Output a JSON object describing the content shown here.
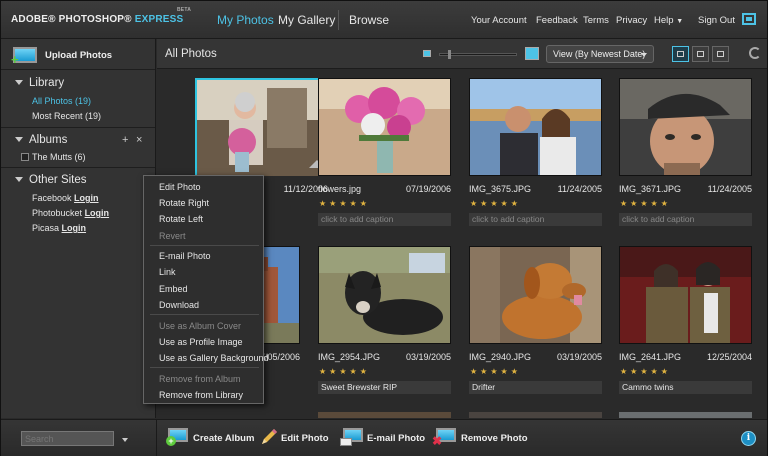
{
  "app": {
    "logo_prefix": "ADOBE® PHOTOSHOP®",
    "logo_express": "EXPRESS",
    "logo_beta": "BETA"
  },
  "topnav": {
    "my_photos": "My Photos",
    "my_gallery": "My Gallery",
    "browse": "Browse",
    "your_account": "Your Account",
    "feedback": "Feedback",
    "terms": "Terms",
    "privacy": "Privacy",
    "help": "Help",
    "sign_out": "Sign Out"
  },
  "sidebar": {
    "upload": "Upload Photos",
    "library": {
      "title": "Library",
      "items": [
        "All Photos (19)",
        "Most Recent (19)"
      ]
    },
    "albums": {
      "title": "Albums",
      "add": "+",
      "remove": "×",
      "items": [
        "The Mutts (6)"
      ]
    },
    "other_sites": {
      "title": "Other Sites",
      "sites": [
        {
          "name": "Facebook",
          "action": "Login"
        },
        {
          "name": "Photobucket",
          "action": "Login"
        },
        {
          "name": "Picasa",
          "action": "Login"
        }
      ]
    }
  },
  "main": {
    "title": "All Photos",
    "view_select": "View (By Newest Date)",
    "photos": [
      {
        "name": "",
        "date": "11/12/2006",
        "caption": "",
        "stars": "★★★★★"
      },
      {
        "name": "flowers.jpg",
        "date": "07/19/2006",
        "caption": "click to add caption",
        "stars": "★★★★★"
      },
      {
        "name": "IMG_3675.JPG",
        "date": "11/24/2005",
        "caption": "click to add caption",
        "stars": "★★★★★"
      },
      {
        "name": "IMG_3671.JPG",
        "date": "11/24/2005",
        "caption": "click to add caption",
        "stars": "★★★★★"
      },
      {
        "name": "",
        "date": "07/05/2006",
        "caption": "",
        "stars": ""
      },
      {
        "name": "IMG_2954.JPG",
        "date": "03/19/2005",
        "caption": "Sweet Brewster RIP",
        "stars": "★★★★★"
      },
      {
        "name": "IMG_2940.JPG",
        "date": "03/19/2005",
        "caption": "Drifter",
        "stars": "★★★★★"
      },
      {
        "name": "IMG_2641.JPG",
        "date": "12/25/2004",
        "caption": "Cammo twins",
        "stars": "★★★★★"
      }
    ]
  },
  "context_menu": {
    "items": [
      {
        "label": "Edit Photo",
        "enabled": true
      },
      {
        "label": "Rotate Right",
        "enabled": true
      },
      {
        "label": "Rotate Left",
        "enabled": true
      },
      {
        "label": "Revert",
        "enabled": false
      },
      {
        "label": "E-mail Photo",
        "enabled": true
      },
      {
        "label": "Link",
        "enabled": true
      },
      {
        "label": "Embed",
        "enabled": true
      },
      {
        "label": "Download",
        "enabled": true
      },
      {
        "label": "Use as Album Cover",
        "enabled": false
      },
      {
        "label": "Use as Profile Image",
        "enabled": true
      },
      {
        "label": "Use as Gallery Background",
        "enabled": true
      },
      {
        "label": "Remove from Album",
        "enabled": false
      },
      {
        "label": "Remove from Library",
        "enabled": true
      }
    ]
  },
  "bottombar": {
    "search_placeholder": "Search",
    "create_album": "Create Album",
    "edit_photo": "Edit Photo",
    "email_photo": "E-mail Photo",
    "remove_photo": "Remove Photo",
    "info": "i"
  },
  "colors": {
    "accent": "#4dc3e6",
    "selection": "#2ec4e0",
    "star": "#e2b440"
  }
}
